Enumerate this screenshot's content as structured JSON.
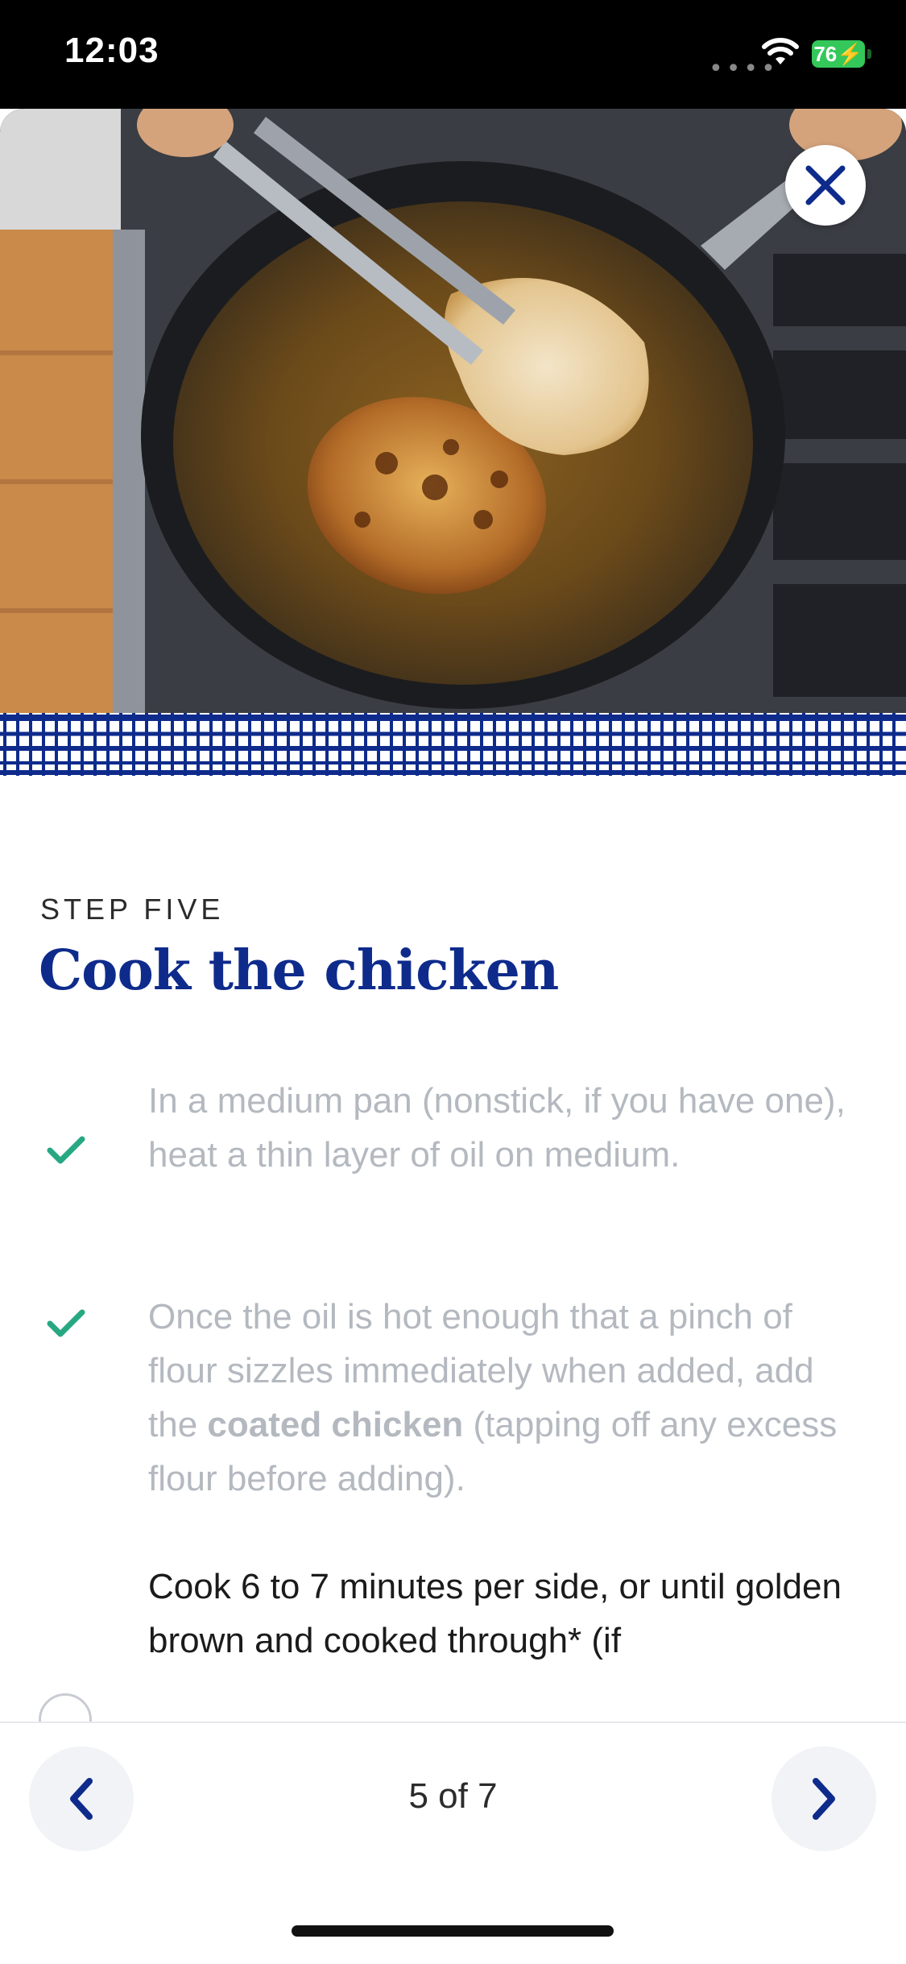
{
  "status_bar": {
    "time": "12:03",
    "battery": "76"
  },
  "hero": {
    "image_desc_icon": "food-photo",
    "close_icon": "close-icon"
  },
  "step": {
    "label": "STEP FIVE",
    "title": "Cook the chicken"
  },
  "instructions": [
    {
      "done": true,
      "text": "In a medium pan (nonstick, if you have one), heat a thin layer of oil on medium."
    },
    {
      "done": true,
      "text_before": "Once the oil is hot enough that a pinch of flour sizzles immediately when added, add the ",
      "bold": "coated chicken",
      "text_after": " (tapping off any excess flour before adding)."
    },
    {
      "done": false,
      "text": "Cook 6 to 7 minutes per side, or until golden brown and cooked through* (if"
    }
  ],
  "navigation": {
    "counter": "5 of 7",
    "prev_icon": "chevron-left-icon",
    "next_icon": "chevron-right-icon"
  },
  "colors": {
    "accent": "#0e2b8c",
    "check": "#27a883",
    "muted_text": "#b4b9c0"
  }
}
